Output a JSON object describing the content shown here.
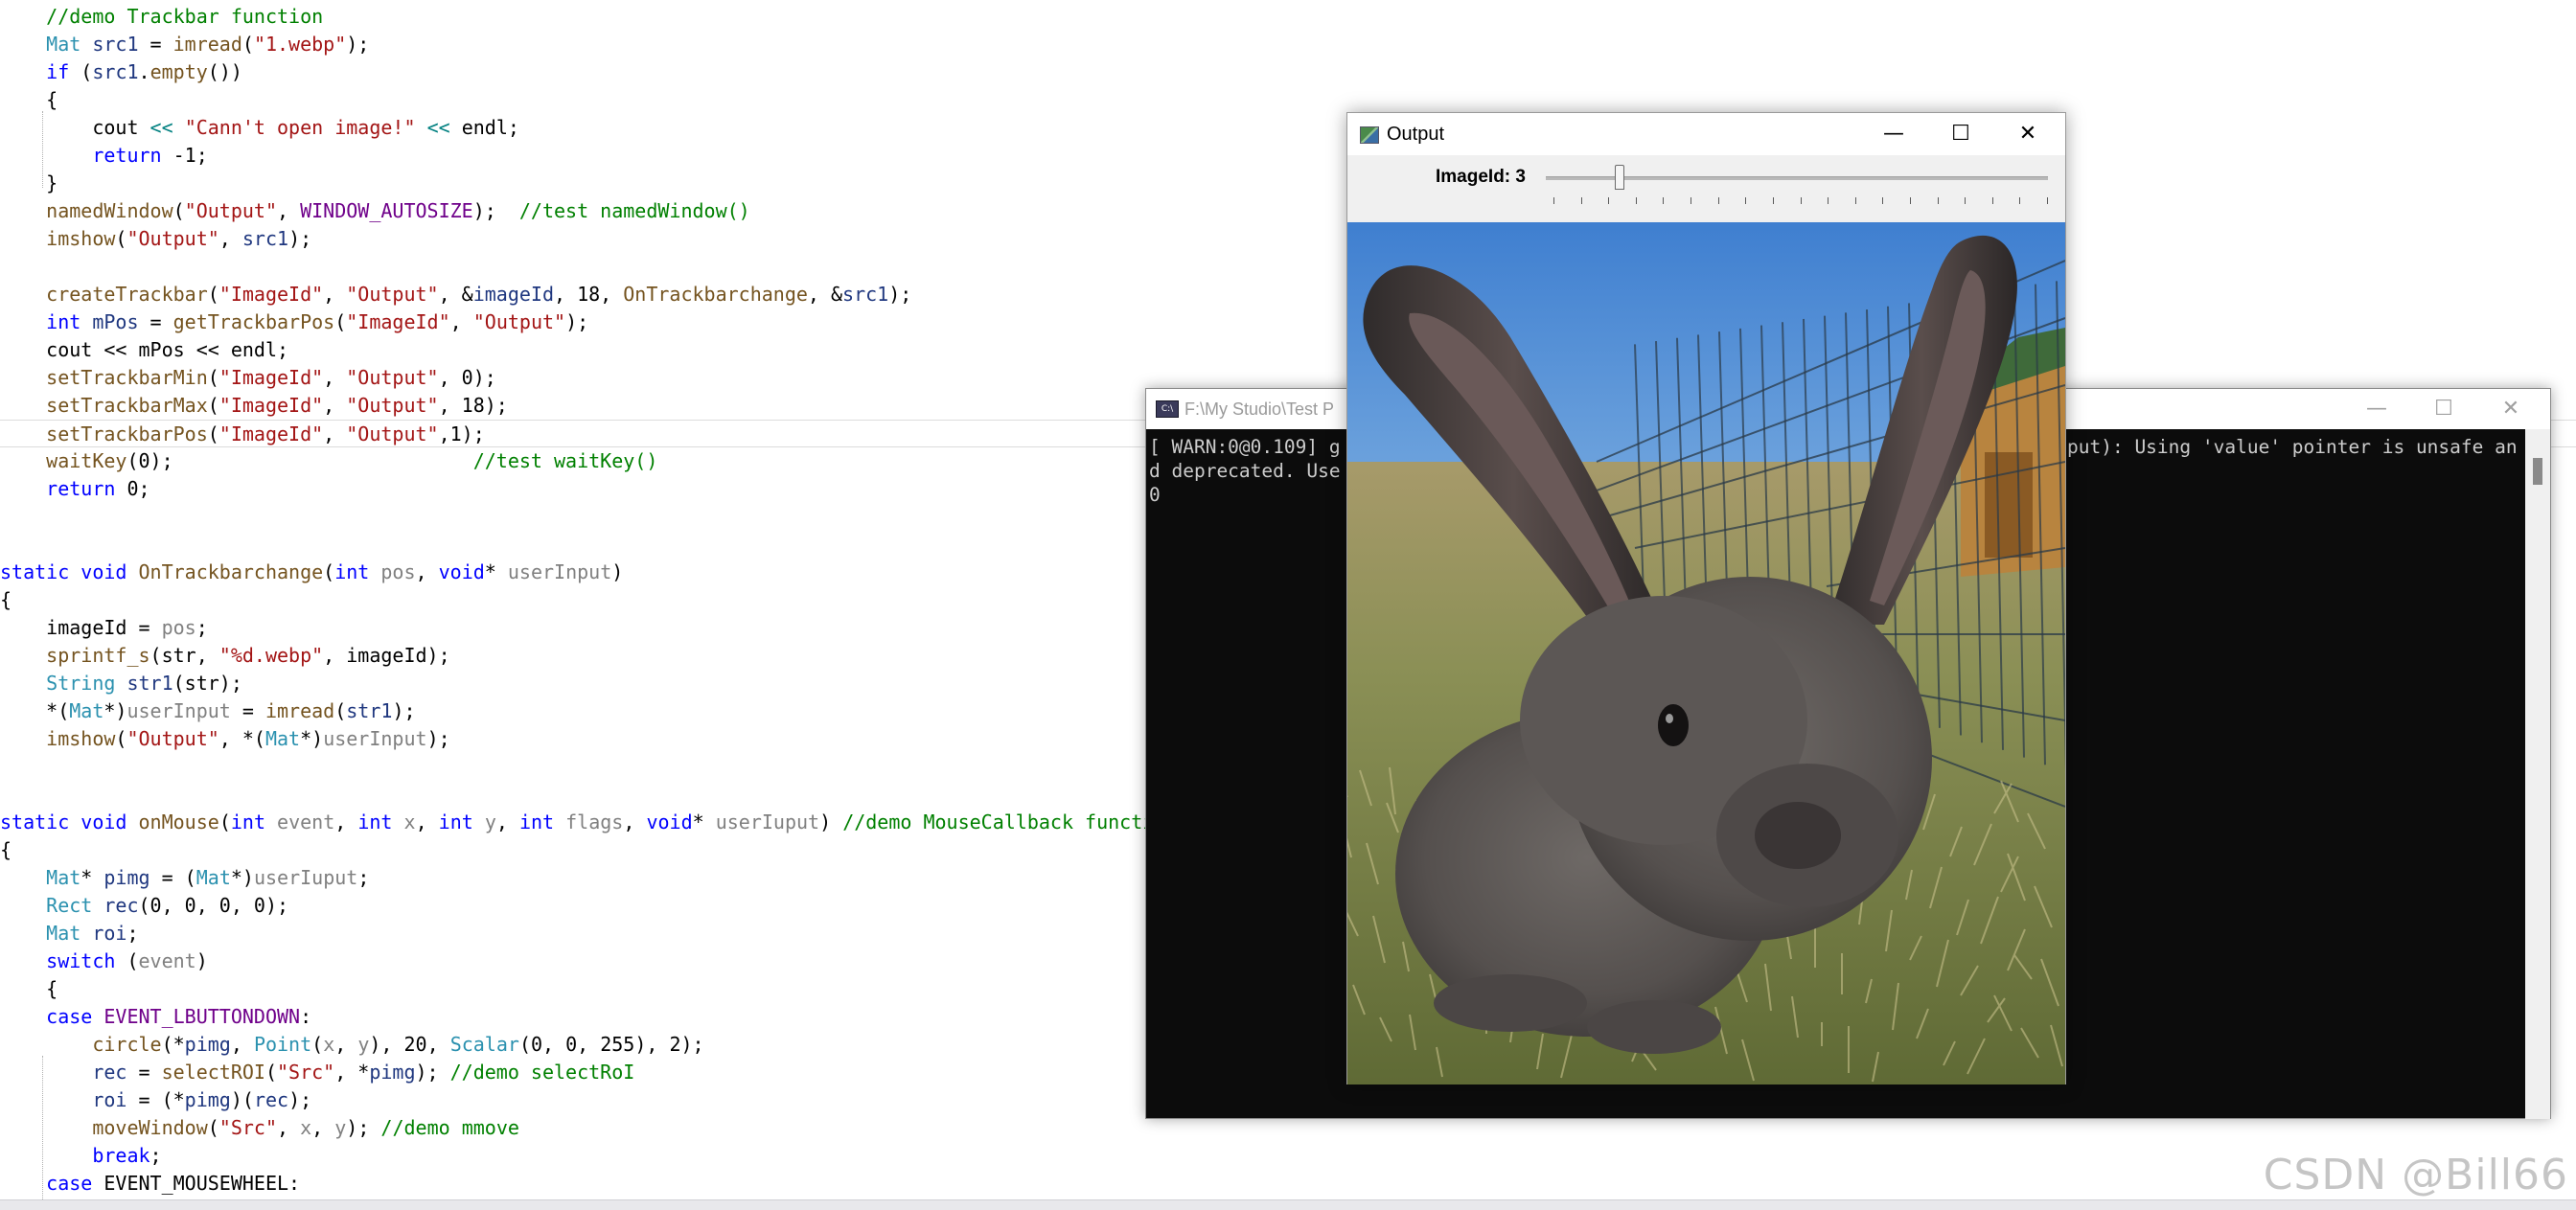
{
  "editor": {
    "lines": [
      [
        [
          "cm",
          "    //demo Trackbar function"
        ]
      ],
      [
        [
          "t",
          "    "
        ],
        [
          "ty",
          "Mat"
        ],
        [
          "t",
          " "
        ],
        [
          "var",
          "src1"
        ],
        [
          "t",
          " = "
        ],
        [
          "fn",
          "imread"
        ],
        [
          "t",
          "("
        ],
        [
          "str",
          "\"1.webp\""
        ],
        [
          "t",
          ");"
        ]
      ],
      [
        [
          "t",
          "    "
        ],
        [
          "kw",
          "if"
        ],
        [
          "t",
          " ("
        ],
        [
          "var",
          "src1"
        ],
        [
          "t",
          "."
        ],
        [
          "fn",
          "empty"
        ],
        [
          "t",
          "())"
        ]
      ],
      [
        [
          "t",
          "    {"
        ]
      ],
      [
        [
          "t",
          "        cout "
        ],
        [
          "op",
          "<<"
        ],
        [
          "t",
          " "
        ],
        [
          "str",
          "\"Cann't open image!\""
        ],
        [
          "t",
          " "
        ],
        [
          "op",
          "<<"
        ],
        [
          "t",
          " endl;"
        ]
      ],
      [
        [
          "t",
          "        "
        ],
        [
          "kw",
          "return"
        ],
        [
          "t",
          " -1;"
        ]
      ],
      [
        [
          "t",
          "    }"
        ]
      ],
      [
        [
          "t",
          "    "
        ],
        [
          "fn",
          "namedWindow"
        ],
        [
          "t",
          "("
        ],
        [
          "str",
          "\"Output\""
        ],
        [
          "t",
          ", "
        ],
        [
          "mac",
          "WINDOW_AUTOSIZE"
        ],
        [
          "t",
          ");  "
        ],
        [
          "cm",
          "//test namedWindow()"
        ]
      ],
      [
        [
          "t",
          "    "
        ],
        [
          "fn",
          "imshow"
        ],
        [
          "t",
          "("
        ],
        [
          "str",
          "\"Output\""
        ],
        [
          "t",
          ", "
        ],
        [
          "var",
          "src1"
        ],
        [
          "t",
          ");"
        ]
      ],
      [
        [
          "t",
          ""
        ]
      ],
      [
        [
          "t",
          "    "
        ],
        [
          "fn",
          "createTrackbar"
        ],
        [
          "t",
          "("
        ],
        [
          "str",
          "\"ImageId\""
        ],
        [
          "t",
          ", "
        ],
        [
          "str",
          "\"Output\""
        ],
        [
          "t",
          ", &"
        ],
        [
          "var",
          "imageId"
        ],
        [
          "t",
          ", 18, "
        ],
        [
          "fn",
          "OnTrackbarchange"
        ],
        [
          "t",
          ", &"
        ],
        [
          "var",
          "src1"
        ],
        [
          "t",
          ");"
        ]
      ],
      [
        [
          "t",
          "    "
        ],
        [
          "kw",
          "int"
        ],
        [
          "t",
          " "
        ],
        [
          "var",
          "mPos"
        ],
        [
          "t",
          " = "
        ],
        [
          "fn",
          "getTrackbarPos"
        ],
        [
          "t",
          "("
        ],
        [
          "str",
          "\"ImageId\""
        ],
        [
          "t",
          ", "
        ],
        [
          "str",
          "\"Output\""
        ],
        [
          "t",
          ");"
        ]
      ],
      [
        [
          "t",
          "    cout << mPos << endl;"
        ]
      ],
      [
        [
          "t",
          "    "
        ],
        [
          "fn",
          "setTrackbarMin"
        ],
        [
          "t",
          "("
        ],
        [
          "str",
          "\"ImageId\""
        ],
        [
          "t",
          ", "
        ],
        [
          "str",
          "\"Output\""
        ],
        [
          "t",
          ", 0);"
        ]
      ],
      [
        [
          "t",
          "    "
        ],
        [
          "fn",
          "setTrackbarMax"
        ],
        [
          "t",
          "("
        ],
        [
          "str",
          "\"ImageId\""
        ],
        [
          "t",
          ", "
        ],
        [
          "str",
          "\"Output\""
        ],
        [
          "t",
          ", 18);"
        ]
      ],
      [
        [
          "t",
          "    "
        ],
        [
          "fn",
          "setTrackbarPos"
        ],
        [
          "t",
          "("
        ],
        [
          "str",
          "\"ImageId\""
        ],
        [
          "t",
          ", "
        ],
        [
          "str",
          "\"Output\""
        ],
        [
          "t",
          ",1);"
        ]
      ],
      [
        [
          "t",
          "    "
        ],
        [
          "fn",
          "waitKey"
        ],
        [
          "t",
          "(0);                          "
        ],
        [
          "cm",
          "//test waitKey()"
        ]
      ],
      [
        [
          "t",
          "    "
        ],
        [
          "kw",
          "return"
        ],
        [
          "t",
          " 0;"
        ]
      ],
      [
        [
          "t",
          ""
        ]
      ],
      [
        [
          "t",
          ""
        ]
      ],
      [
        [
          "kw",
          "static"
        ],
        [
          "t",
          " "
        ],
        [
          "kw",
          "void"
        ],
        [
          "t",
          " "
        ],
        [
          "fn",
          "OnTrackbarchange"
        ],
        [
          "t",
          "("
        ],
        [
          "kw",
          "int"
        ],
        [
          "t",
          " "
        ],
        [
          "param",
          "pos"
        ],
        [
          "t",
          ", "
        ],
        [
          "kw",
          "void"
        ],
        [
          "t",
          "* "
        ],
        [
          "param",
          "userInput"
        ],
        [
          "t",
          ")"
        ]
      ],
      [
        [
          "t",
          "{"
        ]
      ],
      [
        [
          "t",
          "    imageId = "
        ],
        [
          "param",
          "pos"
        ],
        [
          "t",
          ";"
        ]
      ],
      [
        [
          "t",
          "    "
        ],
        [
          "fn",
          "sprintf_s"
        ],
        [
          "t",
          "(str, "
        ],
        [
          "str",
          "\"%d.webp\""
        ],
        [
          "t",
          ", imageId);"
        ]
      ],
      [
        [
          "t",
          "    "
        ],
        [
          "ty",
          "String"
        ],
        [
          "t",
          " "
        ],
        [
          "var",
          "str1"
        ],
        [
          "t",
          "(str);"
        ]
      ],
      [
        [
          "t",
          "    *("
        ],
        [
          "ty",
          "Mat"
        ],
        [
          "t",
          "*)"
        ],
        [
          "param",
          "userInput"
        ],
        [
          "t",
          " = "
        ],
        [
          "fn",
          "imread"
        ],
        [
          "t",
          "("
        ],
        [
          "var",
          "str1"
        ],
        [
          "t",
          ");"
        ]
      ],
      [
        [
          "t",
          "    "
        ],
        [
          "fn",
          "imshow"
        ],
        [
          "t",
          "("
        ],
        [
          "str",
          "\"Output\""
        ],
        [
          "t",
          ", *("
        ],
        [
          "ty",
          "Mat"
        ],
        [
          "t",
          "*)"
        ],
        [
          "param",
          "userInput"
        ],
        [
          "t",
          ");"
        ]
      ],
      [
        [
          "t",
          ""
        ]
      ],
      [
        [
          "t",
          ""
        ]
      ],
      [
        [
          "kw",
          "static"
        ],
        [
          "t",
          " "
        ],
        [
          "kw",
          "void"
        ],
        [
          "t",
          " "
        ],
        [
          "fn",
          "onMouse"
        ],
        [
          "t",
          "("
        ],
        [
          "kw",
          "int"
        ],
        [
          "t",
          " "
        ],
        [
          "param",
          "event"
        ],
        [
          "t",
          ", "
        ],
        [
          "kw",
          "int"
        ],
        [
          "t",
          " "
        ],
        [
          "param",
          "x"
        ],
        [
          "t",
          ", "
        ],
        [
          "kw",
          "int"
        ],
        [
          "t",
          " "
        ],
        [
          "param",
          "y"
        ],
        [
          "t",
          ", "
        ],
        [
          "kw",
          "int"
        ],
        [
          "t",
          " "
        ],
        [
          "param",
          "flags"
        ],
        [
          "t",
          ", "
        ],
        [
          "kw",
          "void"
        ],
        [
          "t",
          "* "
        ],
        [
          "param",
          "userIuput"
        ],
        [
          "t",
          ") "
        ],
        [
          "cm",
          "//demo MouseCallback function"
        ]
      ],
      [
        [
          "t",
          "{"
        ]
      ],
      [
        [
          "t",
          "    "
        ],
        [
          "ty",
          "Mat"
        ],
        [
          "t",
          "* "
        ],
        [
          "var",
          "pimg"
        ],
        [
          "t",
          " = ("
        ],
        [
          "ty",
          "Mat"
        ],
        [
          "t",
          "*)"
        ],
        [
          "param",
          "userIuput"
        ],
        [
          "t",
          ";"
        ]
      ],
      [
        [
          "t",
          "    "
        ],
        [
          "ty",
          "Rect"
        ],
        [
          "t",
          " "
        ],
        [
          "var",
          "rec"
        ],
        [
          "t",
          "(0, 0, 0, 0);"
        ]
      ],
      [
        [
          "t",
          "    "
        ],
        [
          "ty",
          "Mat"
        ],
        [
          "t",
          " "
        ],
        [
          "var",
          "roi"
        ],
        [
          "t",
          ";"
        ]
      ],
      [
        [
          "t",
          "    "
        ],
        [
          "kw",
          "switch"
        ],
        [
          "t",
          " ("
        ],
        [
          "param",
          "event"
        ],
        [
          "t",
          ")"
        ]
      ],
      [
        [
          "t",
          "    {"
        ]
      ],
      [
        [
          "t",
          "    "
        ],
        [
          "kw",
          "case"
        ],
        [
          "t",
          " "
        ],
        [
          "mac",
          "EVENT_LBUTTONDOWN"
        ],
        [
          "t",
          ":"
        ]
      ],
      [
        [
          "t",
          "        "
        ],
        [
          "fn",
          "circle"
        ],
        [
          "t",
          "(*"
        ],
        [
          "var",
          "pimg"
        ],
        [
          "t",
          ", "
        ],
        [
          "ty",
          "Point"
        ],
        [
          "t",
          "("
        ],
        [
          "param",
          "x"
        ],
        [
          "t",
          ", "
        ],
        [
          "param",
          "y"
        ],
        [
          "t",
          "), 20, "
        ],
        [
          "ty",
          "Scalar"
        ],
        [
          "t",
          "(0, 0, 255), 2);"
        ]
      ],
      [
        [
          "t",
          "        "
        ],
        [
          "var",
          "rec"
        ],
        [
          "t",
          " = "
        ],
        [
          "fn",
          "selectROI"
        ],
        [
          "t",
          "("
        ],
        [
          "str",
          "\"Src\""
        ],
        [
          "t",
          ", *"
        ],
        [
          "var",
          "pimg"
        ],
        [
          "t",
          "); "
        ],
        [
          "cm",
          "//demo selectRoI"
        ]
      ],
      [
        [
          "t",
          "        "
        ],
        [
          "var",
          "roi"
        ],
        [
          "t",
          " = (*"
        ],
        [
          "var",
          "pimg"
        ],
        [
          "t",
          ")("
        ],
        [
          "var",
          "rec"
        ],
        [
          "t",
          ");"
        ]
      ],
      [
        [
          "t",
          "        "
        ],
        [
          "fn",
          "moveWindow"
        ],
        [
          "t",
          "("
        ],
        [
          "str",
          "\"Src\""
        ],
        [
          "t",
          ", "
        ],
        [
          "param",
          "x"
        ],
        [
          "t",
          ", "
        ],
        [
          "param",
          "y"
        ],
        [
          "t",
          "); "
        ],
        [
          "cm",
          "//demo mmove"
        ]
      ],
      [
        [
          "t",
          "        "
        ],
        [
          "kw",
          "break"
        ],
        [
          "t",
          ";"
        ]
      ],
      [
        [
          "t",
          "    "
        ],
        [
          "kw",
          "case"
        ],
        [
          "t",
          " EVENT_MOUSEWHEEL:"
        ]
      ]
    ]
  },
  "console": {
    "title": "F:\\My Studio\\Test P",
    "line1": "[ WARN:0@0.109] g",
    "line1_right": "put): Using 'value' pointer is unsafe an",
    "line2": "d deprecated. Use",
    "line3": "0",
    "minimize": "—",
    "maximize": "☐",
    "close": "✕",
    "icon_text": "C:\\"
  },
  "output": {
    "title": "Output",
    "trackbar_label": "ImageId: 3",
    "trackbar_value": 3,
    "trackbar_min": 0,
    "trackbar_max": 18,
    "minimize": "—",
    "maximize": "☐",
    "close": "✕"
  },
  "watermark": "CSDN @Bill66",
  "colors": {
    "keyword": "#0000ff",
    "type": "#2b91af",
    "function": "#74531f",
    "string": "#a31515",
    "comment": "#008000",
    "console_bg": "#0c0c0c"
  }
}
